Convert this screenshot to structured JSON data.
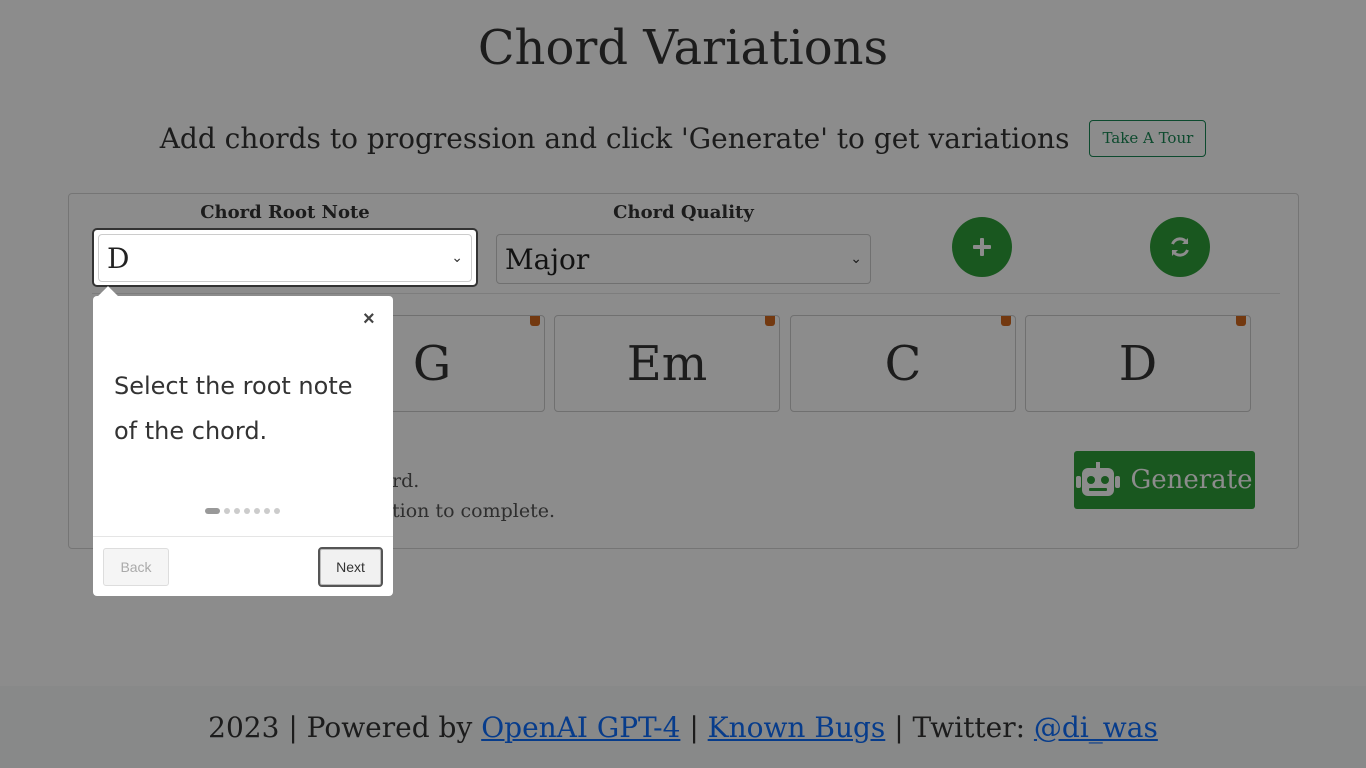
{
  "header": {
    "title": "Chord Variations",
    "subtitle": "Add chords to progression and click 'Generate' to get variations",
    "tour_label": "Take A Tour"
  },
  "form": {
    "root_label": "Chord Root Note",
    "root_value": "D",
    "quality_label": "Chord Quality",
    "quality_value": "Major",
    "add_icon": "plus-icon",
    "reset_icon": "refresh-icon"
  },
  "progression": {
    "chords": [
      "G",
      "Em",
      "C",
      "D"
    ]
  },
  "hints": {
    "line1": "rd.",
    "line2": "tion to complete."
  },
  "generate": {
    "label": "Generate",
    "icon": "robot-icon"
  },
  "footer": {
    "prefix": "2023 | Powered by",
    "link1": "OpenAI GPT-4",
    "sep1": "|",
    "link2": "Known Bugs",
    "twitter_prefix": "| Twitter:",
    "link3": "@di_was"
  },
  "tour": {
    "text": "Select the root note of the chord.",
    "close": "×",
    "back_label": "Back",
    "next_label": "Next",
    "steps_total": 7,
    "current_step": 1
  },
  "colors": {
    "accent_green": "#2e9e3a",
    "chord_corner": "#d2691e",
    "link_blue": "#0d6efd"
  }
}
